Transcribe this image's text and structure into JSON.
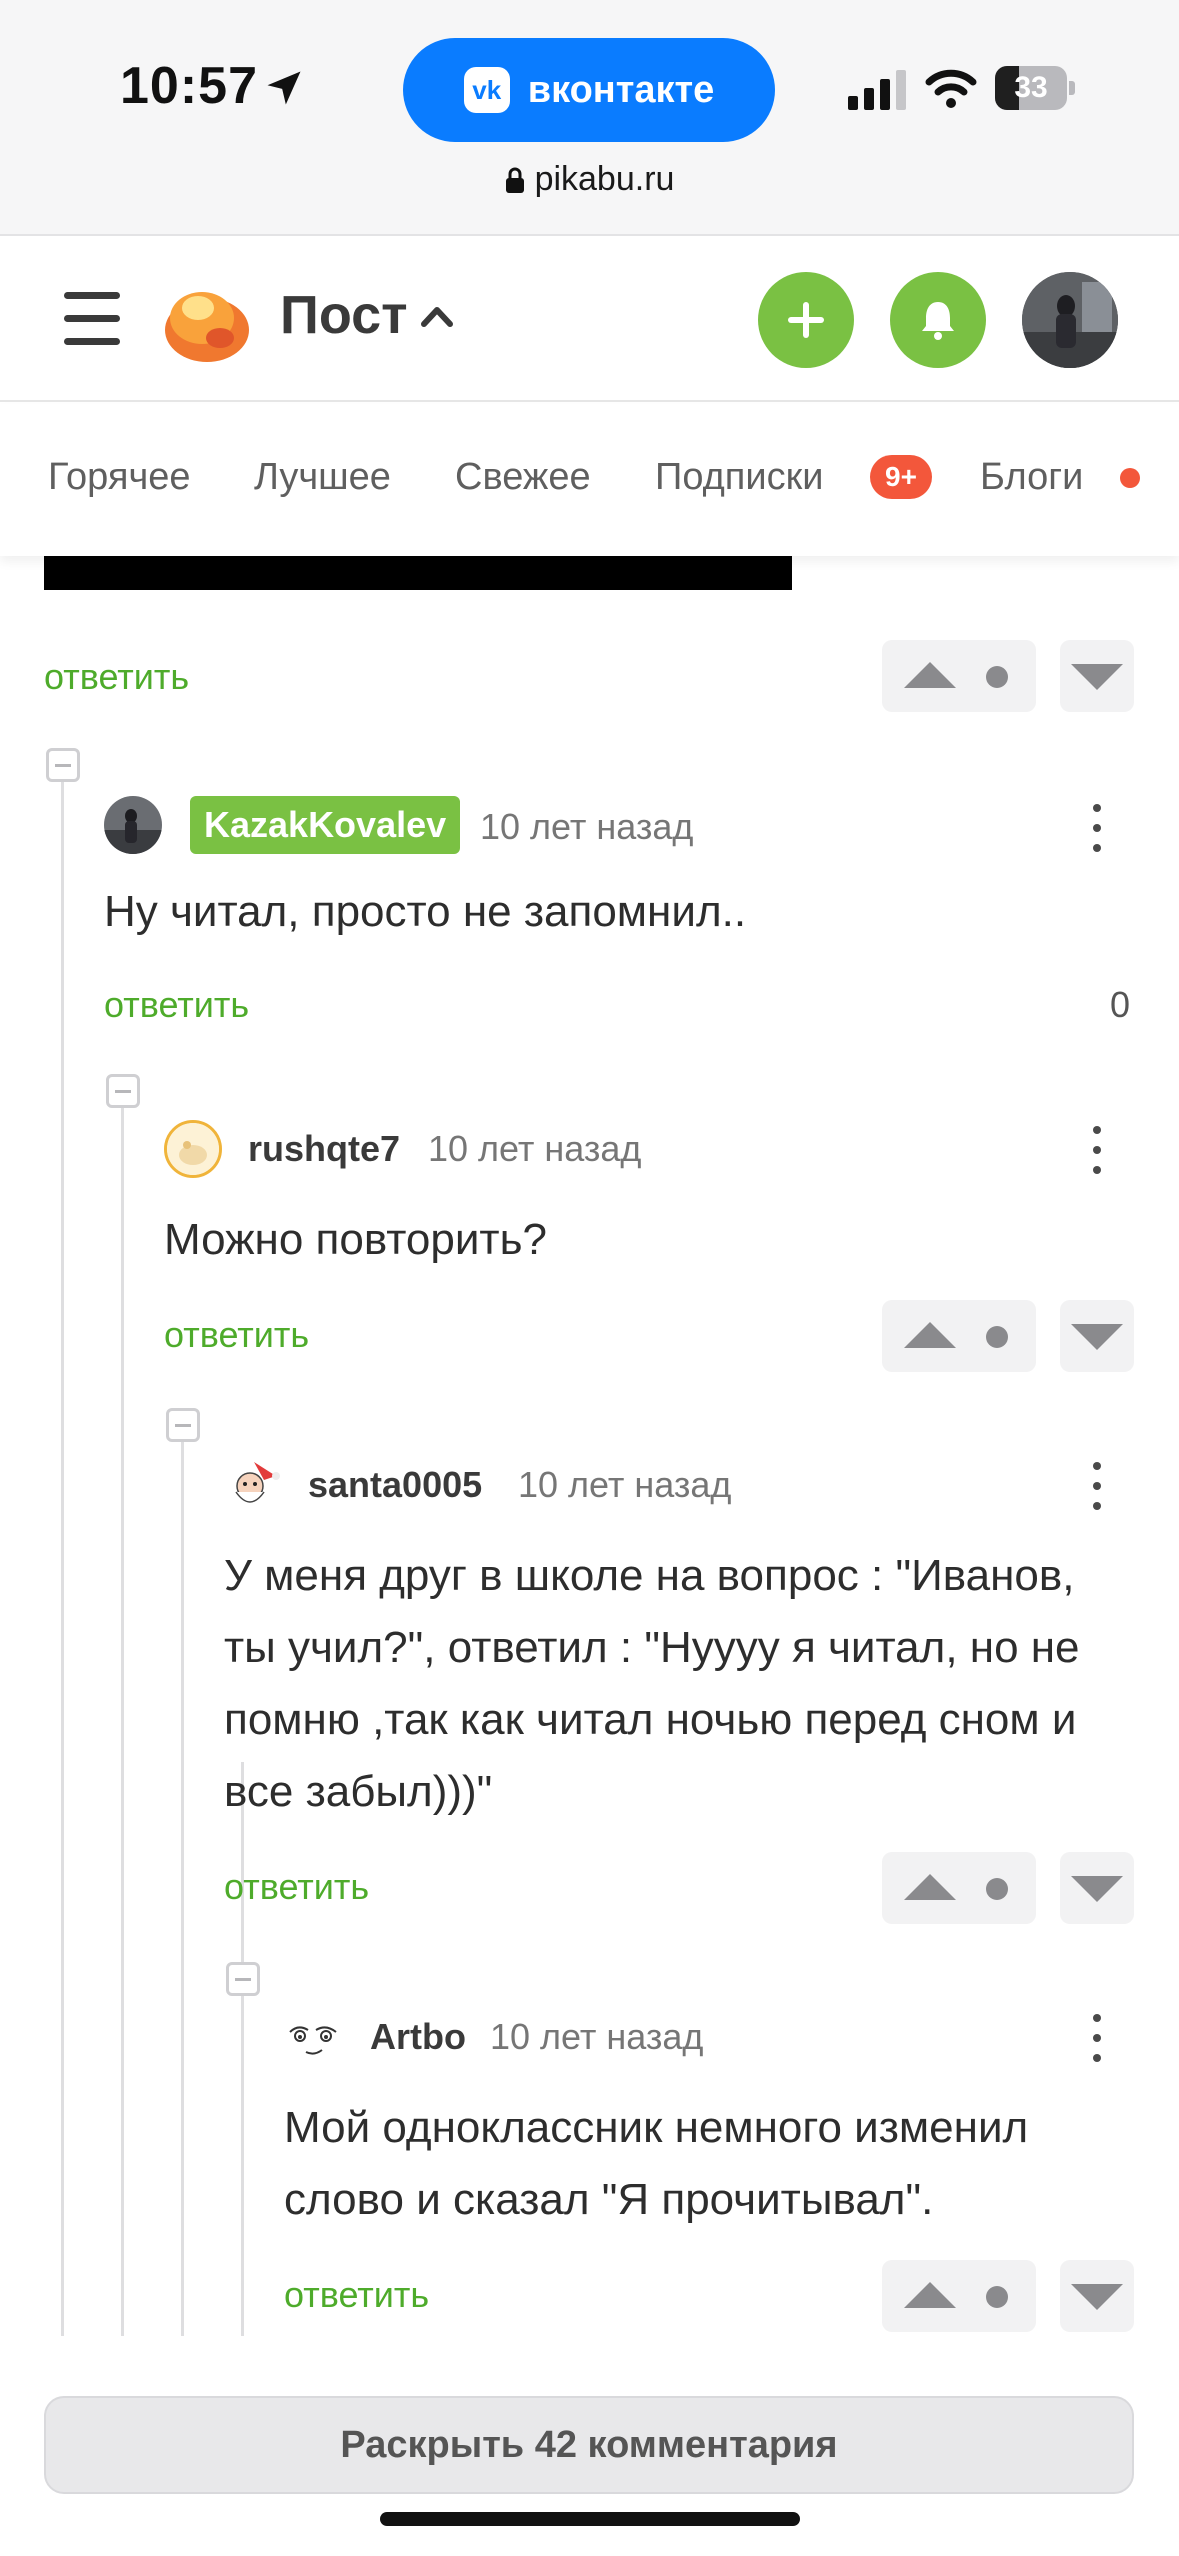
{
  "status_bar": {
    "time": "10:57",
    "vk_label": "вконтакте",
    "battery": "33",
    "battery_level": 0.33,
    "url": "pikabu.ru"
  },
  "header": {
    "title": "Пост"
  },
  "tabs": {
    "hot": "Горячее",
    "best": "Лучшее",
    "fresh": "Свежее",
    "subs": "Подписки",
    "subs_badge": "9+",
    "blogs": "Блоги"
  },
  "thread": {
    "reply_label": "ответить",
    "comments": [
      {
        "author": "KazakKovalev",
        "time": "10 лет назад",
        "text": "Ну читал, просто не запомнил..",
        "score": "0"
      },
      {
        "author": "rushqte7",
        "time": "10 лет назад",
        "text": "Можно повторить?"
      },
      {
        "author": "santa0005",
        "time": "10 лет назад",
        "text": "У меня друг в школе на вопрос : \"Иванов, ты учил?\", ответил : \"Нуууу я читал, но не помню ,так как читал ночью перед сном и все забыл)))\""
      },
      {
        "author": "Artbo",
        "time": "10 лет назад",
        "text": "Мой одноклассник немного изменил слово и сказал \"Я прочитывал\"."
      }
    ]
  },
  "footer": {
    "expand_label": "Раскрыть 42 комментария"
  },
  "colors": {
    "accent_green": "#7ac143",
    "link_green": "#4eab2b",
    "badge_red": "#f3573b",
    "vk_blue": "#0a7cff"
  },
  "icons": [
    "location-arrow-icon",
    "vk-icon",
    "signal-icon",
    "wifi-icon",
    "battery-icon",
    "lock-icon",
    "menu-icon",
    "pikabu-logo-icon",
    "chevron-up-icon",
    "plus-icon",
    "bell-icon",
    "vote-up-icon",
    "vote-down-icon",
    "collapse-icon",
    "more-icon"
  ]
}
